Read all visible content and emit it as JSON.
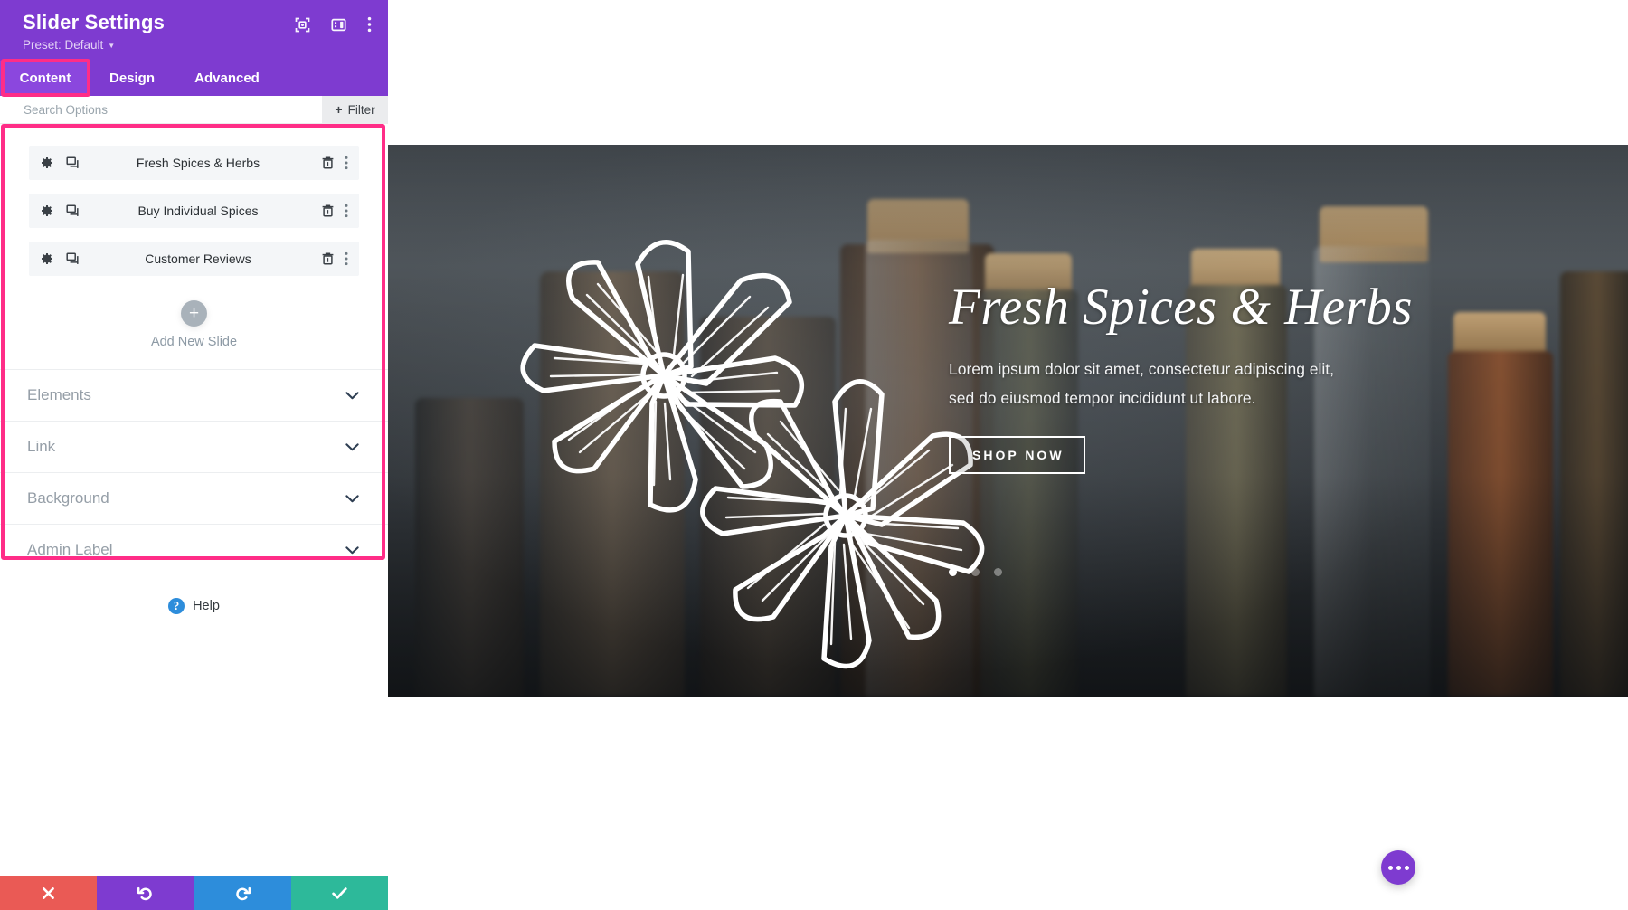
{
  "panel": {
    "title": "Slider Settings",
    "preset_label": "Preset: Default",
    "header_icons": [
      {
        "name": "focus-frame-icon"
      },
      {
        "name": "panel-layout-icon"
      },
      {
        "name": "kebab-menu-icon"
      }
    ],
    "tabs": [
      {
        "id": "content",
        "label": "Content",
        "active": true
      },
      {
        "id": "design",
        "label": "Design",
        "active": false
      },
      {
        "id": "advanced",
        "label": "Advanced",
        "active": false
      }
    ],
    "search": {
      "placeholder": "Search Options",
      "value": ""
    },
    "filter_button": {
      "label": "Filter",
      "plus": "+"
    },
    "slides": [
      {
        "name": "Fresh Spices & Herbs"
      },
      {
        "name": "Buy Individual Spices"
      },
      {
        "name": "Customer Reviews"
      }
    ],
    "add_slide": {
      "label": "Add New Slide",
      "plus": "+"
    },
    "accordions": [
      {
        "label": "Elements"
      },
      {
        "label": "Link"
      },
      {
        "label": "Background"
      },
      {
        "label": "Admin Label"
      }
    ],
    "help": {
      "label": "Help",
      "glyph": "?"
    },
    "actions": [
      {
        "id": "cancel",
        "name": "cancel-button",
        "glyph": "✕",
        "color": "#ea5a55"
      },
      {
        "id": "undo",
        "name": "undo-button",
        "glyph": "↺",
        "color": "#7E3BD0"
      },
      {
        "id": "redo",
        "name": "redo-button",
        "glyph": "↻",
        "color": "#2d8ddb"
      },
      {
        "id": "save",
        "name": "save-button",
        "glyph": "✔",
        "color": "#2db99a"
      }
    ]
  },
  "preview": {
    "slide": {
      "title": "Fresh Spices & Herbs",
      "description": "Lorem ipsum dolor sit amet, consectetur adipiscing elit, sed do eiusmod tempor incididunt ut labore.",
      "button_label": "SHOP NOW"
    },
    "pagination": {
      "total": 3,
      "active_index": 0
    },
    "fab_name": "page-settings-fab"
  },
  "colors": {
    "brand_purple": "#7E3BD0",
    "tab_active_purple": "#8B47DE",
    "highlight_pink": "#FF2D87",
    "slide_row_bg": "#f4f6f8",
    "stage_dark": "#41474d",
    "cancel_red": "#ea5a55",
    "redo_blue": "#2d8ddb",
    "save_green": "#2db99a"
  }
}
